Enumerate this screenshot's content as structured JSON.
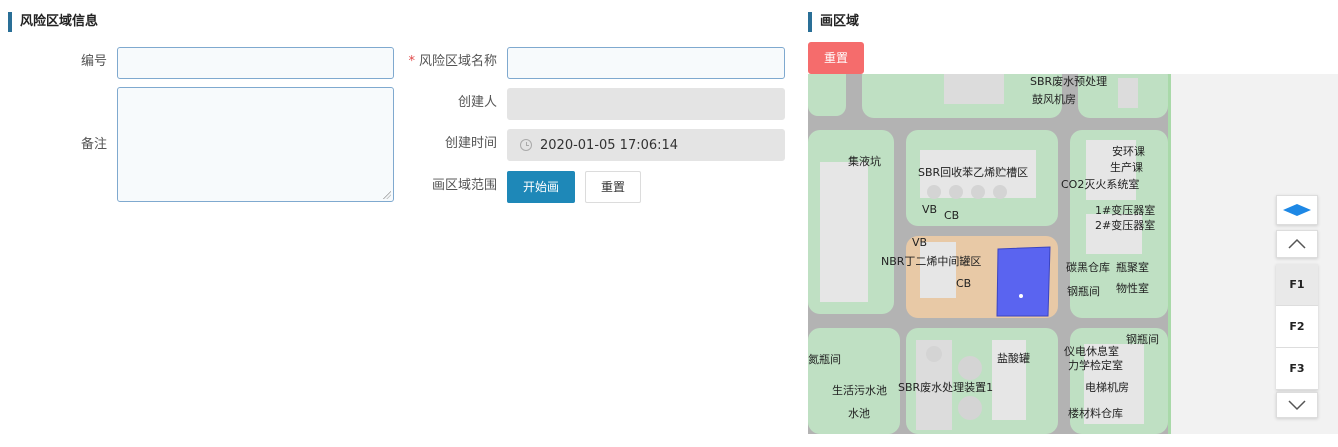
{
  "left_panel": {
    "title": "风险区域信息",
    "labels": {
      "number": "编号",
      "area_name": "风险区域名称",
      "required_mark": "*",
      "remark": "备注",
      "creator": "创建人",
      "created_time": "创建时间",
      "draw_range": "画区域范围"
    },
    "values": {
      "number": "",
      "area_name": "",
      "remark": "",
      "creator": "",
      "created_time": "2020-01-05 17:06:14"
    },
    "buttons": {
      "start_draw": "开始画",
      "reset": "重置"
    }
  },
  "right_panel": {
    "title": "画区域",
    "reset_button": "重置",
    "map_labels": [
      "SBR废水预处理",
      "鼓风机房",
      "集液坑",
      "SBR回收苯乙烯贮槽区",
      "VB",
      "CB",
      "安环课",
      "生产课",
      "CO2灭火系统室",
      "1#变压器室",
      "2#变压器室",
      "VB",
      "NBR丁二烯中间罐区",
      "CB",
      "碳黑仓库",
      "瓶聚室",
      "钢瓶间",
      "物性室",
      "氮瓶间",
      "盐酸罐",
      "仪电休息室",
      "力学检定室",
      "钢瓶间",
      "生活污水池",
      "SBR废水处理装置1",
      "电梯机房",
      "水池",
      "楼材料仓库"
    ],
    "floors": [
      "F1",
      "F2",
      "F3"
    ],
    "active_floor": "F1"
  },
  "colors": {
    "accent": "#2a6f97",
    "primary_button": "#1e88b8",
    "danger_button": "#f56c6c",
    "drawn_area": "#5a64f0",
    "map_green": "#bfe0c3",
    "map_tan": "#e8c9a6"
  }
}
